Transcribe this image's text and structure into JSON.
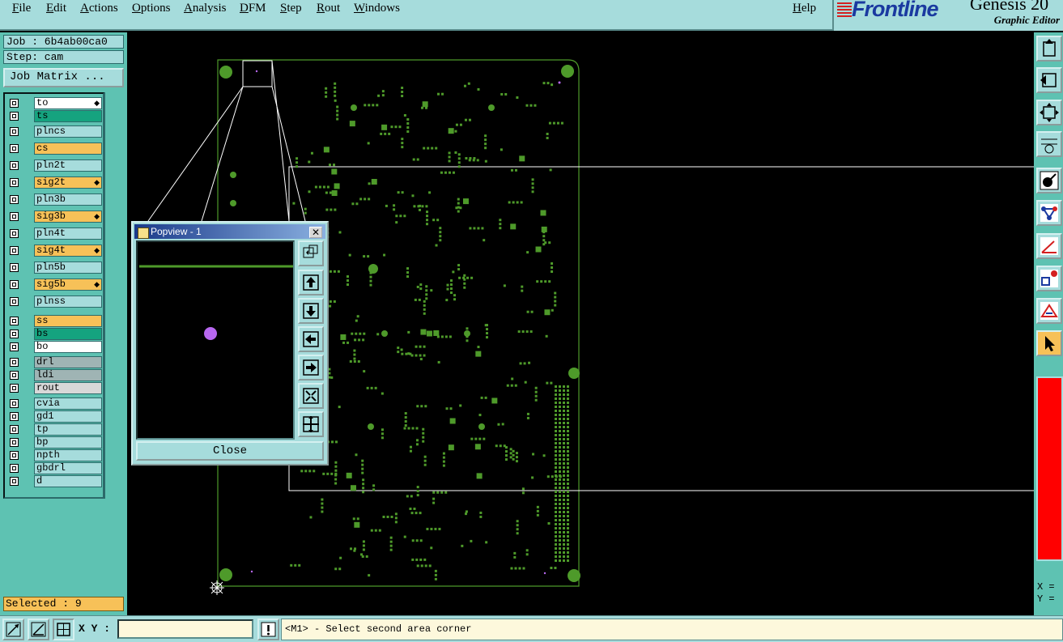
{
  "menu": [
    "File",
    "Edit",
    "Actions",
    "Options",
    "Analysis",
    "DFM",
    "Step",
    "Rout",
    "Windows"
  ],
  "help": "Help",
  "brand": {
    "logo": "Frontline",
    "product": "Genesis 20",
    "subtitle": "Graphic Editor"
  },
  "job": "Job : 6b4ab00ca0",
  "step": "Step: cam",
  "job_matrix": "Job Matrix ...",
  "layers": [
    {
      "name": "to",
      "color": "#ffffff",
      "flag": true
    },
    {
      "name": "ts",
      "color": "#15a37f",
      "flag": false
    },
    {
      "name": "plncs",
      "color": "#a6dcdc",
      "flag": false
    },
    {
      "name": "cs",
      "color": "#f7c158",
      "flag": false
    },
    {
      "name": "pln2t",
      "color": "#a6dcdc",
      "flag": false
    },
    {
      "name": "sig2t",
      "color": "#f7c158",
      "flag": true
    },
    {
      "name": "pln3b",
      "color": "#a6dcdc",
      "flag": false
    },
    {
      "name": "sig3b",
      "color": "#f7c158",
      "flag": true
    },
    {
      "name": "pln4t",
      "color": "#a6dcdc",
      "flag": false
    },
    {
      "name": "sig4t",
      "color": "#f7c158",
      "flag": true
    },
    {
      "name": "pln5b",
      "color": "#a6dcdc",
      "flag": false
    },
    {
      "name": "sig5b",
      "color": "#f7c158",
      "flag": true
    },
    {
      "name": "plnss",
      "color": "#a6dcdc",
      "flag": false
    },
    {
      "name": "ss",
      "color": "#f7c158",
      "flag": false
    },
    {
      "name": "bs",
      "color": "#15a37f",
      "flag": false
    },
    {
      "name": "bo",
      "color": "#ffffff",
      "flag": false
    },
    {
      "name": "drl",
      "color": "#9fb4b4",
      "flag": false
    },
    {
      "name": "ldi",
      "color": "#9fb4b4",
      "flag": false
    },
    {
      "name": "rout",
      "color": "#d8d8d8",
      "flag": false
    },
    {
      "name": "cvia",
      "color": "#a6dcdc",
      "flag": false
    },
    {
      "name": "gd1",
      "color": "#a6dcdc",
      "flag": false
    },
    {
      "name": "tp",
      "color": "#a6dcdc",
      "flag": false
    },
    {
      "name": "bp",
      "color": "#a6dcdc",
      "flag": false
    },
    {
      "name": "npth",
      "color": "#a6dcdc",
      "flag": false
    },
    {
      "name": "gbdrl",
      "color": "#a6dcdc",
      "flag": false
    },
    {
      "name": "d",
      "color": "#a6dcdc",
      "flag": false
    }
  ],
  "selected": "Selected : 9",
  "popview": {
    "title": "Popview - 1",
    "close_label": "Close"
  },
  "xy_label": "X Y :",
  "xy_value": "",
  "status_message": "<M1> - Select second area corner",
  "readout": {
    "x": "X =",
    "y": "Y ="
  },
  "colors": {
    "panel": "#a6dcdc",
    "teal": "#5ec2b2",
    "pad": "#4e9a2a",
    "highlight": "#f7c158",
    "probe": "#b868f0"
  }
}
